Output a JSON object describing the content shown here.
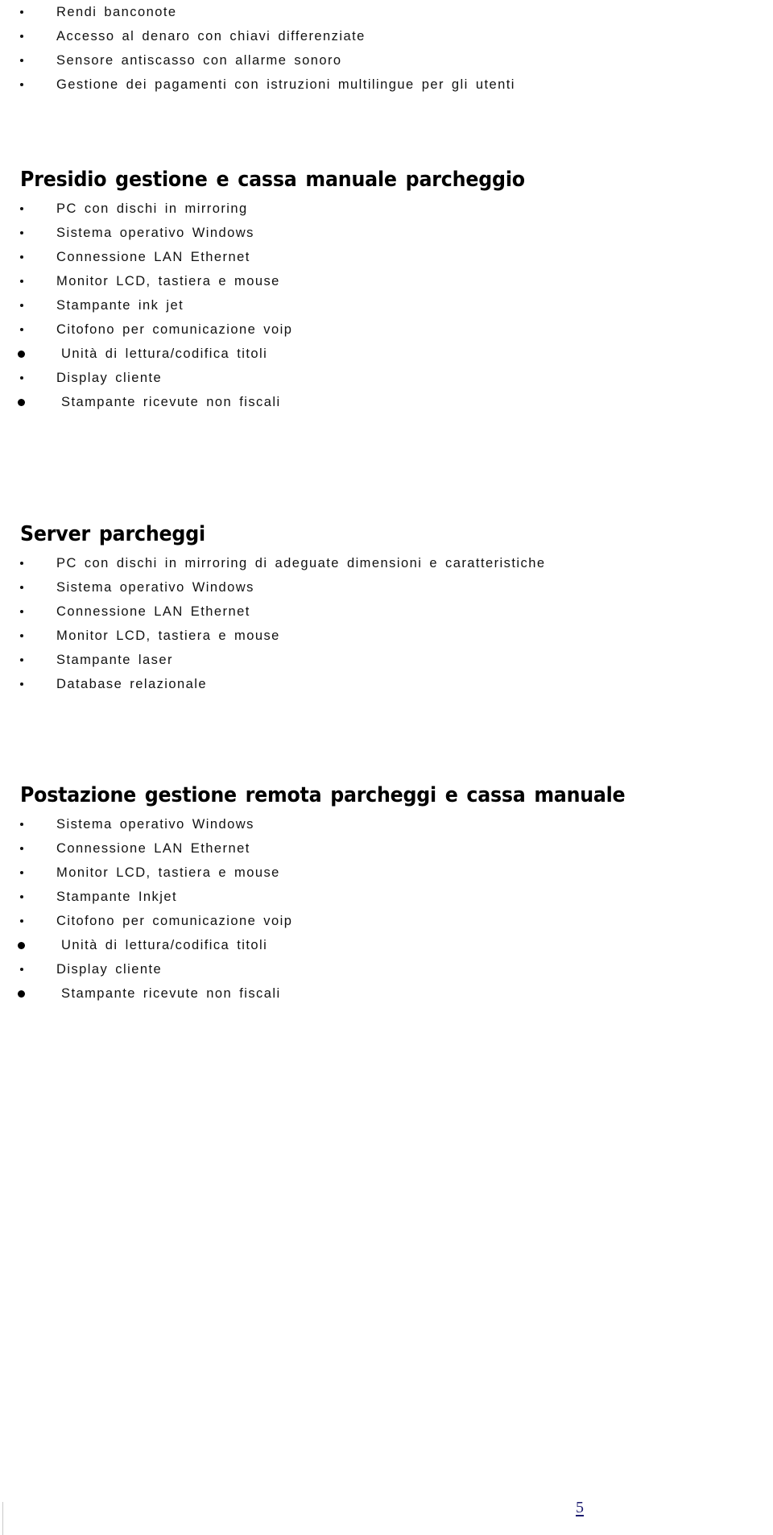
{
  "document": {
    "page_number": "5",
    "page_number_color": "#1a1a6e"
  },
  "intro_list": {
    "items": [
      {
        "bullet": "dot",
        "text": "Rendi banconote"
      },
      {
        "bullet": "dot",
        "text": "Accesso al denaro con chiavi differenziate"
      },
      {
        "bullet": "dot",
        "text": "Sensore antiscasso con allarme sonoro"
      },
      {
        "bullet": "dot",
        "text": "Gestione dei pagamenti con istruzioni multilingue per gli utenti"
      }
    ]
  },
  "section_1": {
    "heading": "Presidio gestione e cassa manuale parcheggio",
    "items": [
      {
        "bullet": "dot",
        "text": "PC con dischi in mirroring"
      },
      {
        "bullet": "dot",
        "text": "Sistema operativo Windows"
      },
      {
        "bullet": "dot",
        "text": "Connessione LAN Ethernet"
      },
      {
        "bullet": "dot",
        "text": "Monitor LCD, tastiera e mouse"
      },
      {
        "bullet": "dot",
        "text": "Stampante ink jet"
      },
      {
        "bullet": "dot",
        "text": "Citofono per comunicazione voip"
      },
      {
        "bullet": "round",
        "text": "Unità di lettura/codifica titoli"
      },
      {
        "bullet": "dot",
        "text": "Display cliente"
      },
      {
        "bullet": "round",
        "text": "Stampante ricevute non fiscali"
      }
    ]
  },
  "section_2": {
    "heading": "Server parcheggi",
    "items": [
      {
        "bullet": "dot",
        "text": "PC con dischi in mirroring di adeguate dimensioni e caratteristiche"
      },
      {
        "bullet": "dot",
        "text": "Sistema operativo Windows"
      },
      {
        "bullet": "dot",
        "text": "Connessione LAN Ethernet"
      },
      {
        "bullet": "dot",
        "text": "Monitor LCD, tastiera e mouse"
      },
      {
        "bullet": "dot",
        "text": "Stampante laser"
      },
      {
        "bullet": "dot",
        "text": "Database relazionale"
      }
    ]
  },
  "section_3": {
    "heading": "Postazione gestione remota parcheggi e cassa manuale",
    "items": [
      {
        "bullet": "dot",
        "text": "Sistema operativo Windows"
      },
      {
        "bullet": "dot",
        "text": "Connessione LAN Ethernet"
      },
      {
        "bullet": "dot",
        "text": "Monitor LCD, tastiera e mouse"
      },
      {
        "bullet": "dot",
        "text": "Stampante Inkjet"
      },
      {
        "bullet": "dot",
        "text": "Citofono per comunicazione voip"
      },
      {
        "bullet": "round",
        "text": "Unità di lettura/codifica titoli"
      },
      {
        "bullet": "dot",
        "text": "Display cliente"
      },
      {
        "bullet": "round",
        "text": "Stampante ricevute non fiscali"
      }
    ]
  }
}
